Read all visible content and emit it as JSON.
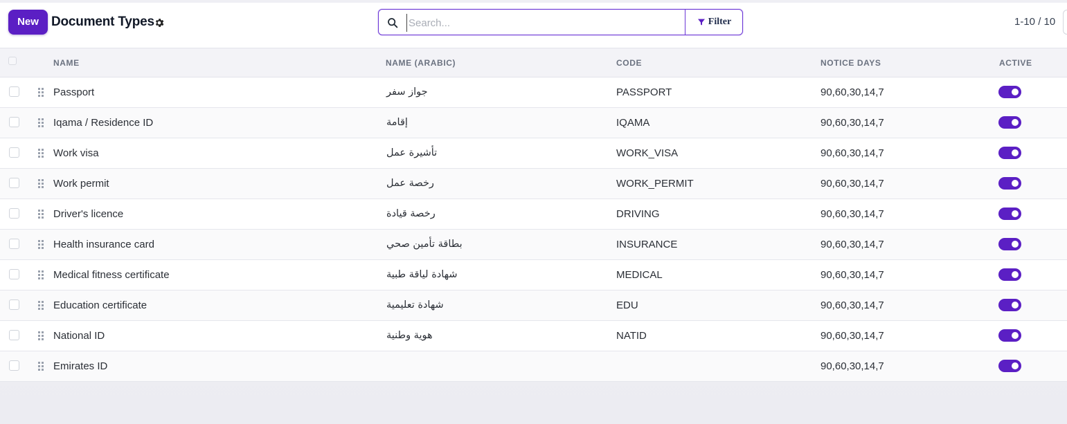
{
  "header": {
    "new_label": "New",
    "title": "Document Types",
    "settings_icon": "gear-icon"
  },
  "search": {
    "placeholder": "Search...",
    "value": "",
    "filter_label": "Filter",
    "search_icon": "search-icon",
    "filter_icon": "funnel-icon"
  },
  "pager": {
    "text": "1-10 / 10"
  },
  "colors": {
    "accent": "#5b1fc4",
    "header_bg": "#f3f3f7"
  },
  "table": {
    "columns": [
      "NAME",
      "NAME (ARABIC)",
      "CODE",
      "NOTICE DAYS",
      "ACTIVE"
    ],
    "rows": [
      {
        "name": "Passport",
        "name_ar": "جواز سفر",
        "code": "PASSPORT",
        "notice_days": "90,60,30,14,7",
        "active": true
      },
      {
        "name": "Iqama / Residence ID",
        "name_ar": "إقامة",
        "code": "IQAMA",
        "notice_days": "90,60,30,14,7",
        "active": true
      },
      {
        "name": "Work visa",
        "name_ar": "تأشيرة عمل",
        "code": "WORK_VISA",
        "notice_days": "90,60,30,14,7",
        "active": true
      },
      {
        "name": "Work permit",
        "name_ar": "رخصة عمل",
        "code": "WORK_PERMIT",
        "notice_days": "90,60,30,14,7",
        "active": true
      },
      {
        "name": "Driver's licence",
        "name_ar": "رخصة قيادة",
        "code": "DRIVING",
        "notice_days": "90,60,30,14,7",
        "active": true
      },
      {
        "name": "Health insurance card",
        "name_ar": "بطاقة تأمين صحي",
        "code": "INSURANCE",
        "notice_days": "90,60,30,14,7",
        "active": true
      },
      {
        "name": "Medical fitness certificate",
        "name_ar": "شهادة لياقة طبية",
        "code": "MEDICAL",
        "notice_days": "90,60,30,14,7",
        "active": true
      },
      {
        "name": "Education certificate",
        "name_ar": "شهادة تعليمية",
        "code": "EDU",
        "notice_days": "90,60,30,14,7",
        "active": true
      },
      {
        "name": "National ID",
        "name_ar": "هوية وطنية",
        "code": "NATID",
        "notice_days": "90,60,30,14,7",
        "active": true
      },
      {
        "name": "Emirates ID",
        "name_ar": "",
        "code": "",
        "notice_days": "90,60,30,14,7",
        "active": true
      }
    ]
  }
}
